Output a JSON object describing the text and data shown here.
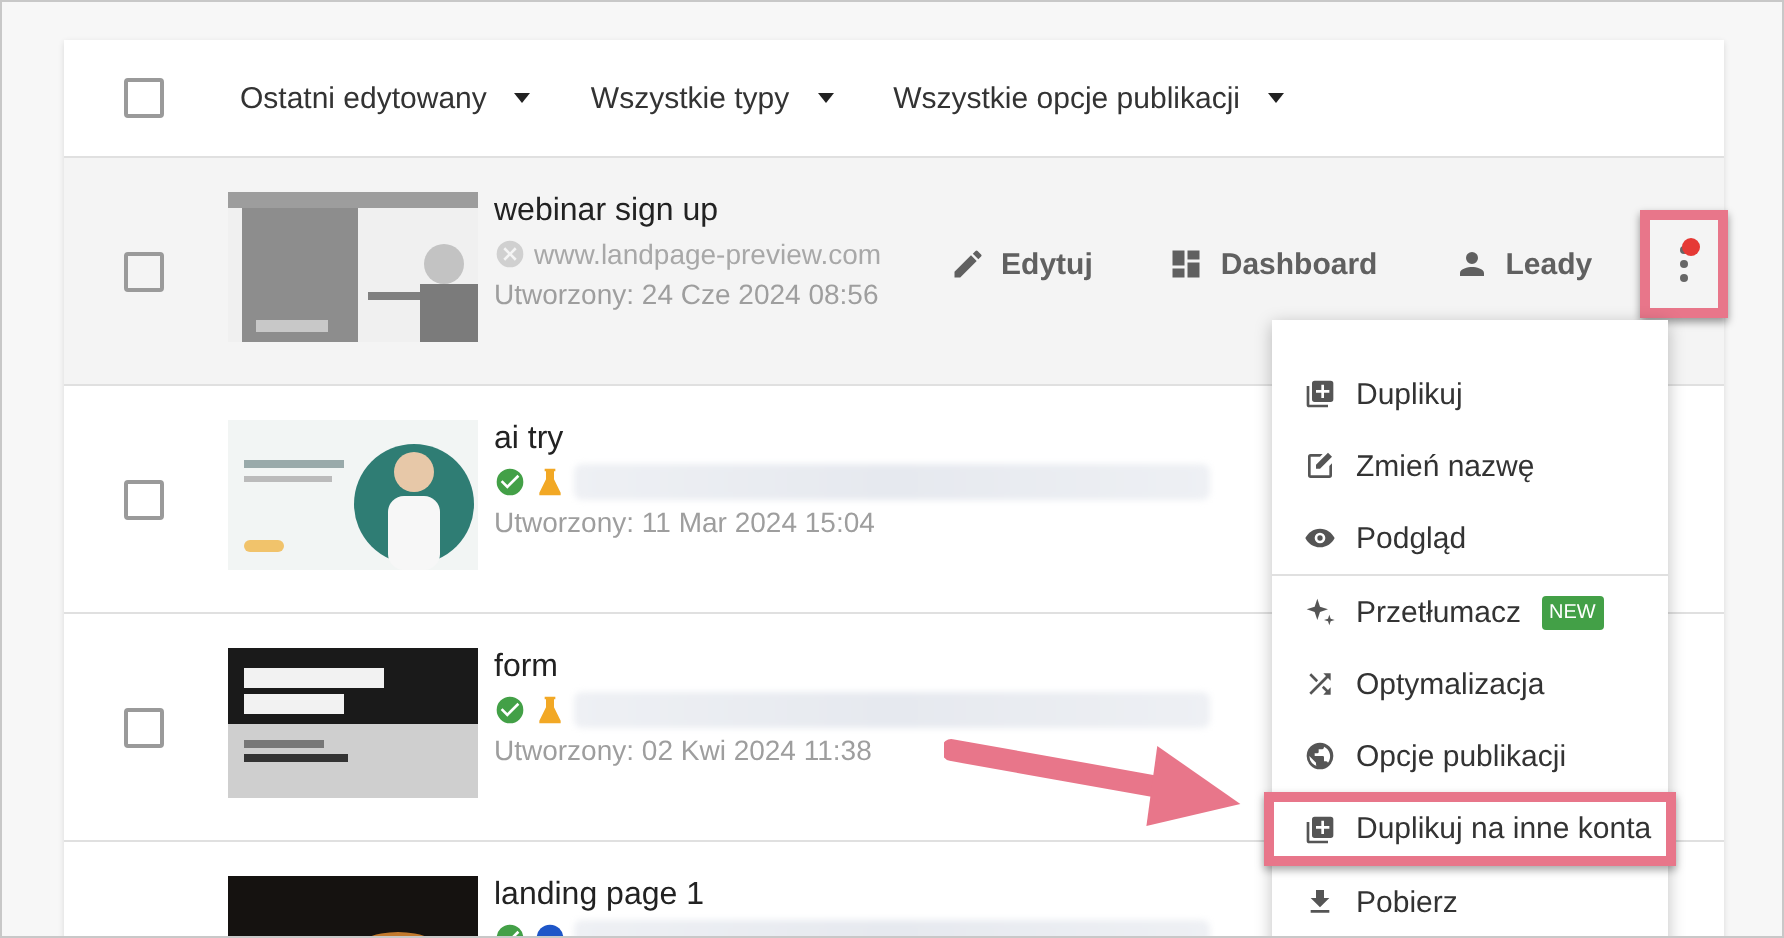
{
  "filters": [
    {
      "label": "Ostatni edytowany"
    },
    {
      "label": "Wszystkie typy"
    },
    {
      "label": "Wszystkie opcje publikacji"
    }
  ],
  "select_all": {
    "checked": false
  },
  "rows": [
    {
      "title": "webinar sign up",
      "checked": false,
      "published": false,
      "status_icons": [
        {
          "kind": "unpublished"
        }
      ],
      "url": "www.landpage-preview.com",
      "created": "Utworzony: 24 Cze 2024 08:56",
      "actions": [
        {
          "kind": "edit",
          "label": "Edytuj"
        },
        {
          "kind": "dashboard",
          "label": "Dashboard"
        },
        {
          "kind": "leads",
          "label": "Leady"
        }
      ],
      "more": {
        "highlighted": true,
        "notification": true
      }
    },
    {
      "title": "ai try",
      "checked": false,
      "published": true,
      "status_icons": [
        {
          "kind": "published"
        },
        {
          "kind": "test"
        }
      ],
      "created": "Utworzony: 11 Mar 2024 15:04"
    },
    {
      "title": "form",
      "checked": false,
      "published": true,
      "status_icons": [
        {
          "kind": "published"
        },
        {
          "kind": "test"
        }
      ],
      "created": "Utworzony: 02 Kwi 2024 11:38"
    },
    {
      "title": "landing page 1",
      "published": true,
      "status_icons": [
        {
          "kind": "published"
        },
        {
          "kind": "domain"
        }
      ]
    }
  ],
  "menu": {
    "items": [
      {
        "kind": "duplicate",
        "label": "Duplikuj",
        "highlighted": false
      },
      {
        "kind": "rename",
        "label": "Zmień nazwę",
        "highlighted": false
      },
      {
        "kind": "preview",
        "label": "Podgląd",
        "highlighted": false
      },
      {
        "kind": "divider"
      },
      {
        "kind": "translate",
        "label": "Przetłumacz",
        "badge": "NEW",
        "highlighted": false
      },
      {
        "kind": "optimize",
        "label": "Optymalizacja",
        "highlighted": false
      },
      {
        "kind": "publish",
        "label": "Opcje publikacji",
        "highlighted": false
      },
      {
        "kind": "duplicate",
        "label": "Duplikuj na inne konta",
        "highlighted": true
      },
      {
        "kind": "download",
        "label": "Pobierz",
        "highlighted": false
      }
    ]
  }
}
